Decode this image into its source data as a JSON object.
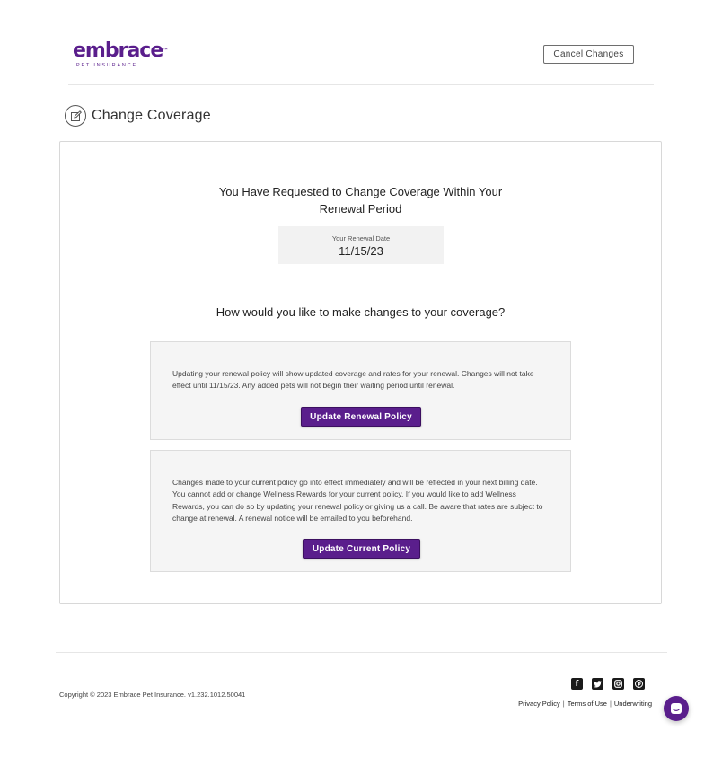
{
  "header": {
    "logo_word": "embrace",
    "logo_tm": "™",
    "logo_sub": "PET INSURANCE",
    "cancel_label": "Cancel Changes"
  },
  "page": {
    "title": "Change Coverage",
    "heading_line1": "You Have Requested to Change Coverage Within Your",
    "heading_line2": "Renewal Period",
    "renewal_label": "Your Renewal Date",
    "renewal_date": "11/15/23",
    "question": "How would you like to make changes to your coverage?"
  },
  "options": [
    {
      "text": "Updating your renewal policy will show updated coverage and rates for your renewal. Changes will not take effect until 11/15/23. Any added pets will not begin their waiting period until renewal.",
      "button": "Update Renewal Policy"
    },
    {
      "text": "Changes made to your current policy go into effect immediately and will be reflected in your next billing date. You cannot add or change Wellness Rewards for your current policy. If you would like to add Wellness Rewards, you can do so by updating your renewal policy or giving us a call. Be aware that rates are subject to change at renewal. A renewal notice will be emailed to you beforehand.",
      "button": "Update Current Policy"
    }
  ],
  "footer": {
    "copyright": "Copyright © 2023   Embrace Pet Insurance. v1.232.1012.50041",
    "links": [
      "Privacy Policy",
      "Terms of Use",
      "Underwriting"
    ],
    "social_icons": [
      "facebook-icon",
      "twitter-icon",
      "instagram-icon",
      "pinterest-icon"
    ]
  },
  "colors": {
    "brand": "#5a1e8c"
  }
}
